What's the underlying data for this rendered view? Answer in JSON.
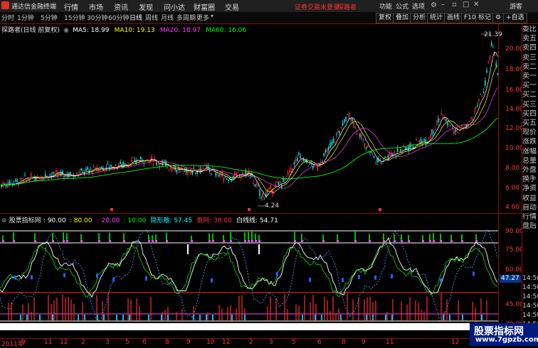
{
  "app": {
    "title": "通达信金融终端",
    "menu": [
      "行情",
      "市场",
      "资讯",
      "发现",
      "问小达",
      "财富圈",
      "交易"
    ],
    "warning": "证券交易未登录",
    "warning2": "探路者",
    "right_menu": [
      "功能",
      "公式",
      "选项"
    ],
    "guest": "游客"
  },
  "toolbar": {
    "periods": [
      "分时",
      "1分钟",
      "5分钟",
      "15分钟",
      "30分钟",
      "60分钟",
      "日线",
      "周线",
      "月线",
      "多周期",
      "更多"
    ],
    "active": "日线",
    "right_buttons": [
      "复权",
      "叠加",
      "分析",
      "统计",
      "画线",
      "F10",
      "标记"
    ],
    "self_select": "+自选"
  },
  "main_panel": {
    "stock": "探路者(日线 前复权)",
    "ma5": "MA5: 18.99",
    "ma10": "MA10: 19.13",
    "ma20": "MA20: 18.97",
    "ma60": "MA60: 16.06",
    "high_label": "21.39",
    "low_label": "4.24",
    "y_ticks": [
      "20.00",
      "18.00",
      "16.00",
      "14.00",
      "12.00",
      "10.00",
      "8.00",
      "6.00",
      "4.00"
    ],
    "colors": {
      "ma5": "#ffffff",
      "ma10": "#ffff00",
      "ma20": "#ff40ff",
      "ma60": "#00ff00",
      "up": "#ff3030",
      "down": "#00ffff"
    }
  },
  "indicator_panel": {
    "name": "股票指标网",
    "v1": ": 90.00",
    "v2": ": 80.00",
    "v3": ": 20.00",
    "v4": ": 10.00",
    "hide_label": "隐形散",
    "hide_val": ": 57.45",
    "fish_label": "鱼网",
    "fish_val": ": 38.00",
    "white_label": "白线线",
    "white_val": ": 54.71",
    "y_ticks": [
      "90.00",
      "75.00",
      "60.00",
      "45.00",
      "30.00"
    ],
    "current": "47.27"
  },
  "date_axis": {
    "year": "2011年",
    "labels": [
      "9",
      "11",
      "12",
      "2",
      "3",
      "5",
      "6",
      "8",
      "9",
      "10",
      "12",
      "2",
      "3",
      "5",
      "6",
      "8",
      "9",
      "11",
      "12"
    ]
  },
  "right_panel": {
    "items": [
      "委比",
      "卖五",
      "卖四",
      "卖三",
      "卖二",
      "卖一",
      "买一",
      "买二",
      "买三",
      "买四",
      "买五",
      "现价",
      "涨跌",
      "涨幅",
      "总量",
      "外盘",
      "换手",
      "净资",
      "收益",
      "自动",
      "行情",
      "盘后"
    ],
    "times": [
      "14:50",
      "14:50",
      "14:50",
      "14:50",
      "14:50",
      "14:50",
      "14:50"
    ]
  },
  "watermark": {
    "title": "股票指标网",
    "url": "www.7gpzb.com"
  }
}
